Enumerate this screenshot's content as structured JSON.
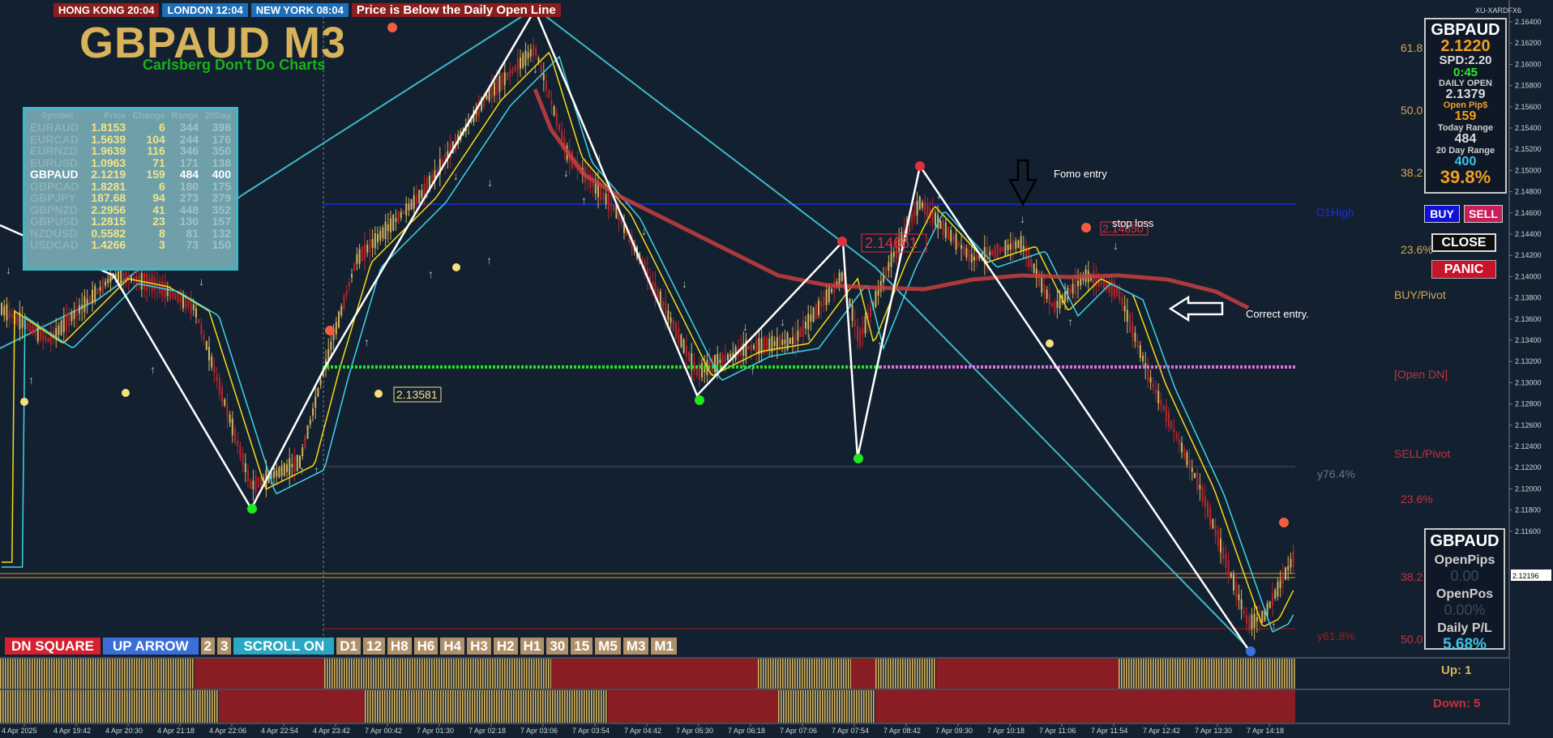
{
  "clocks": {
    "hong_kong": "HONG KONG 20:04",
    "london": "LONDON  12:04",
    "new_york": "NEW YORK  08:04",
    "message": "Price is Below the Daily Open Line"
  },
  "chart_title": "GBPAUD M3",
  "chart_subtitle": "Carlsberg Don't Do Charts",
  "broker_label": "XU-XARDFX6",
  "watchlist": {
    "headers": [
      "Symbol",
      "Price",
      "Change",
      "Range",
      "20Day"
    ],
    "rows": [
      {
        "symbol": "EURAUD",
        "price": "1.8153",
        "change": "6",
        "range": "344",
        "day20": "398"
      },
      {
        "symbol": "EURCAD",
        "price": "1.5639",
        "change": "104",
        "range": "244",
        "day20": "176"
      },
      {
        "symbol": "EURNZD",
        "price": "1.9639",
        "change": "116",
        "range": "346",
        "day20": "350"
      },
      {
        "symbol": "EURUSD",
        "price": "1.0963",
        "change": "71",
        "range": "171",
        "day20": "138"
      },
      {
        "symbol": "GBPAUD",
        "price": "2.1219",
        "change": "159",
        "range": "484",
        "day20": "400"
      },
      {
        "symbol": "GBPCAD",
        "price": "1.8281",
        "change": "6",
        "range": "180",
        "day20": "175"
      },
      {
        "symbol": "GBPJPY",
        "price": "187.68",
        "change": "94",
        "range": "273",
        "day20": "279"
      },
      {
        "symbol": "GBPNZD",
        "price": "2.2956",
        "change": "41",
        "range": "448",
        "day20": "352"
      },
      {
        "symbol": "GBPUSD",
        "price": "1.2815",
        "change": "23",
        "range": "130",
        "day20": "157"
      },
      {
        "symbol": "NZDUSD",
        "price": "0.5582",
        "change": "8",
        "range": "81",
        "day20": "132"
      },
      {
        "symbol": "USDCAD",
        "price": "1.4266",
        "change": "3",
        "range": "73",
        "day20": "150"
      }
    ]
  },
  "info_panel": {
    "symbol": "GBPAUD",
    "price": "2.1220",
    "spread": "SPD:2.20",
    "timer": "0:45",
    "daily_open_label": "DAILY OPEN",
    "daily_open_value": "2.1379",
    "open_pips_label": "Open Pip$",
    "open_pips_value": "159",
    "today_range_label": "Today Range",
    "today_range_value": "484",
    "day20_label": "20 Day Range",
    "day20_value": "400",
    "percent": "39.8%"
  },
  "buttons": {
    "buy": "BUY",
    "sell": "SELL",
    "close": "CLOSE",
    "panic": "PANIC"
  },
  "pl_panel": {
    "symbol": "GBPAUD",
    "open_pips_label": "OpenPips",
    "open_pips_value": "0.00",
    "open_pos_label": "OpenPos",
    "open_pos_value": "0.00%",
    "daily_pl_label": "Daily P/L",
    "daily_pl_value": "5.68%"
  },
  "timeframe_bar": {
    "dn_square": "DN SQUARE",
    "up_arrow": "UP ARROW",
    "num_2": "2",
    "num_3": "3",
    "scroll": "SCROLL ON",
    "tfs": [
      "D1",
      "12",
      "H8",
      "H6",
      "H4",
      "H3",
      "H2",
      "H1",
      "30",
      "15",
      "M5",
      "M3",
      "M1"
    ]
  },
  "side_labels": {
    "fib_618": "61.8",
    "fib_500": "50.0",
    "fib_382": "38.2",
    "d1high": "D1High",
    "fib_236": "23.6%",
    "buy_pivot": "BUY/Pivot",
    "open_dn": "[Open DN]",
    "sell_pivot": "SELL/Pivot",
    "y764": "y76.4%",
    "fib_236b": "23.6%",
    "fib_382b": "38.2",
    "y618": "y61.8%",
    "fib_500b": "50.0"
  },
  "annotations": {
    "fomo": "Fomo entry",
    "stop_loss": "stop loss",
    "correct": "Correct entry.",
    "price_label": "2.13581",
    "red_label1": "2.14661",
    "red_label2": "2.14650"
  },
  "up_count": "Up: 1",
  "down_count": "Down: 5",
  "price_axis": [
    "2.16400",
    "2.16200",
    "2.16000",
    "2.15800",
    "2.15600",
    "2.15400",
    "2.15200",
    "2.15000",
    "2.14800",
    "2.14600",
    "2.14400",
    "2.14200",
    "2.14000",
    "2.13800",
    "2.13600",
    "2.13400",
    "2.13200",
    "2.13000",
    "2.12800",
    "2.12600",
    "2.12400",
    "2.12200",
    "2.12000",
    "2.11800",
    "2.11600"
  ],
  "current_price_tag": "2.12196",
  "time_axis": [
    "4 Apr 2025",
    "4 Apr 19:42",
    "4 Apr 20:30",
    "4 Apr 21:18",
    "4 Apr 22:06",
    "4 Apr 22:54",
    "4 Apr 23:42",
    "7 Apr 00:42",
    "7 Apr 01:30",
    "7 Apr 02:18",
    "7 Apr 03:06",
    "7 Apr 03:54",
    "7 Apr 04:42",
    "7 Apr 05:30",
    "7 Apr 06:18",
    "7 Apr 07:06",
    "7 Apr 07:54",
    "7 Apr 08:42",
    "7 Apr 09:30",
    "7 Apr 10:18",
    "7 Apr 11:06",
    "7 Apr 11:54",
    "7 Apr 12:42",
    "7 Apr 13:30",
    "7 Apr 14:18"
  ],
  "colors": {
    "background": "#13202f",
    "bull_candle": "#d7b35c",
    "bear_candle": "#c0282c",
    "ma_yellow": "#f5dc14",
    "ma_cyan": "#3cd3e8",
    "ma_red": "#c84040",
    "zigzag": "#ffffff",
    "trend": "#3fb9c9",
    "open_line": "#22e622"
  }
}
